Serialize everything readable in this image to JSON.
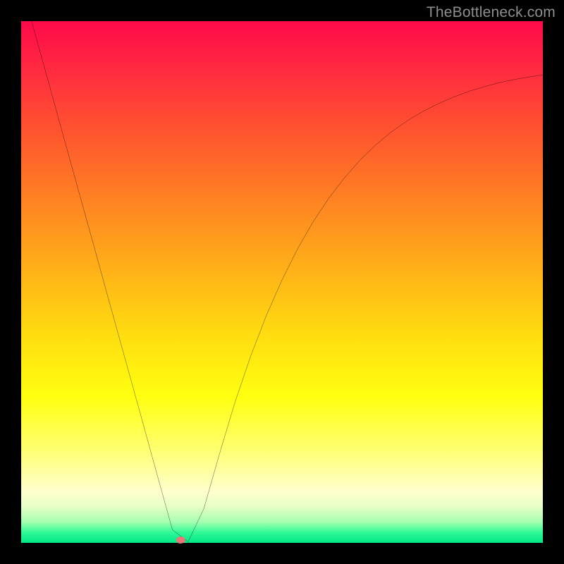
{
  "watermark": "TheBottleneck.com",
  "chart_data": {
    "type": "line",
    "title": "",
    "xlabel": "",
    "ylabel": "",
    "xlim": [
      0,
      100
    ],
    "ylim": [
      0,
      100
    ],
    "grid": false,
    "legend": false,
    "background": {
      "type": "vertical-gradient",
      "top_color": "#ff0a4a",
      "bottom_color": "#00e884",
      "meaning_top": "severe bottleneck",
      "meaning_bottom": "no bottleneck"
    },
    "series": [
      {
        "name": "bottleneck-curve",
        "x": [
          2,
          5,
          8,
          11,
          14,
          17,
          20,
          23,
          26,
          29,
          32,
          35,
          38,
          41,
          44,
          47,
          50,
          53,
          56,
          59,
          62,
          65,
          68,
          71,
          74,
          77,
          80,
          83,
          86,
          89,
          92,
          95,
          98,
          100
        ],
        "values": [
          100,
          89.2,
          78.3,
          67.5,
          56.7,
          45.8,
          35.0,
          24.2,
          13.3,
          2.5,
          0.2,
          6.5,
          17.0,
          27.0,
          35.8,
          43.6,
          50.4,
          56.4,
          61.6,
          66.1,
          70.0,
          73.4,
          76.3,
          78.8,
          80.9,
          82.7,
          84.2,
          85.5,
          86.6,
          87.5,
          88.3,
          88.9,
          89.4,
          89.7
        ]
      }
    ],
    "marker": {
      "name": "optimal-point",
      "x": 30.5,
      "y": 0.6,
      "color": "#e97878"
    }
  }
}
